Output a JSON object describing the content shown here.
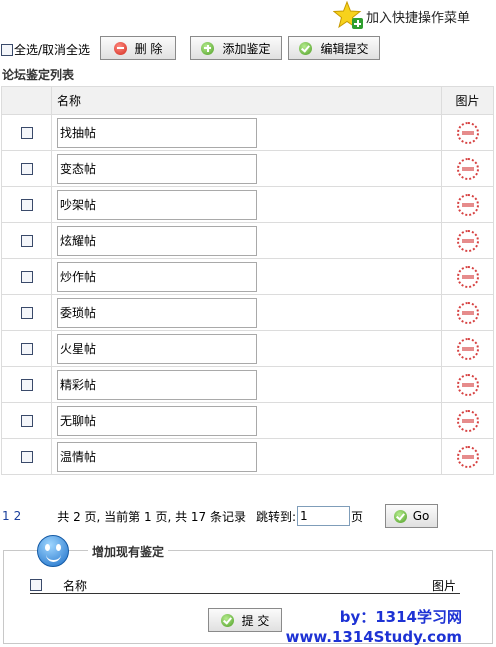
{
  "quick_add": {
    "label": "加入快捷操作菜单",
    "icon": "star-add-icon"
  },
  "toolbar": {
    "select_all_label": "全选/取消全选",
    "delete_label": "删 除",
    "add_label": "添加鉴定",
    "edit_label": "编辑提交"
  },
  "list": {
    "title": "论坛鉴定列表",
    "columns": [
      "",
      "名称",
      "图片"
    ],
    "rows": [
      {
        "name": "找抽帖"
      },
      {
        "name": "变态帖"
      },
      {
        "name": "吵架帖"
      },
      {
        "name": "炫耀帖"
      },
      {
        "name": "炒作帖"
      },
      {
        "name": "委琐帖"
      },
      {
        "name": "火星帖"
      },
      {
        "name": "精彩帖"
      },
      {
        "name": "无聊帖"
      },
      {
        "name": "温情帖"
      }
    ]
  },
  "pager": {
    "pages": [
      "1",
      "2"
    ],
    "info": "共 2 页, 当前第 1 页, 共 17 条记录",
    "jump_label": "跳转到:",
    "jump_value": "1",
    "page_unit": "页",
    "go_label": "Go"
  },
  "add_section": {
    "legend": "增加现有鉴定",
    "col_name": "名称",
    "col_pic": "图片",
    "submit_label": "提 交"
  },
  "watermark": {
    "line1": "by：1314学习网",
    "line2": "www.1314Study.com"
  }
}
